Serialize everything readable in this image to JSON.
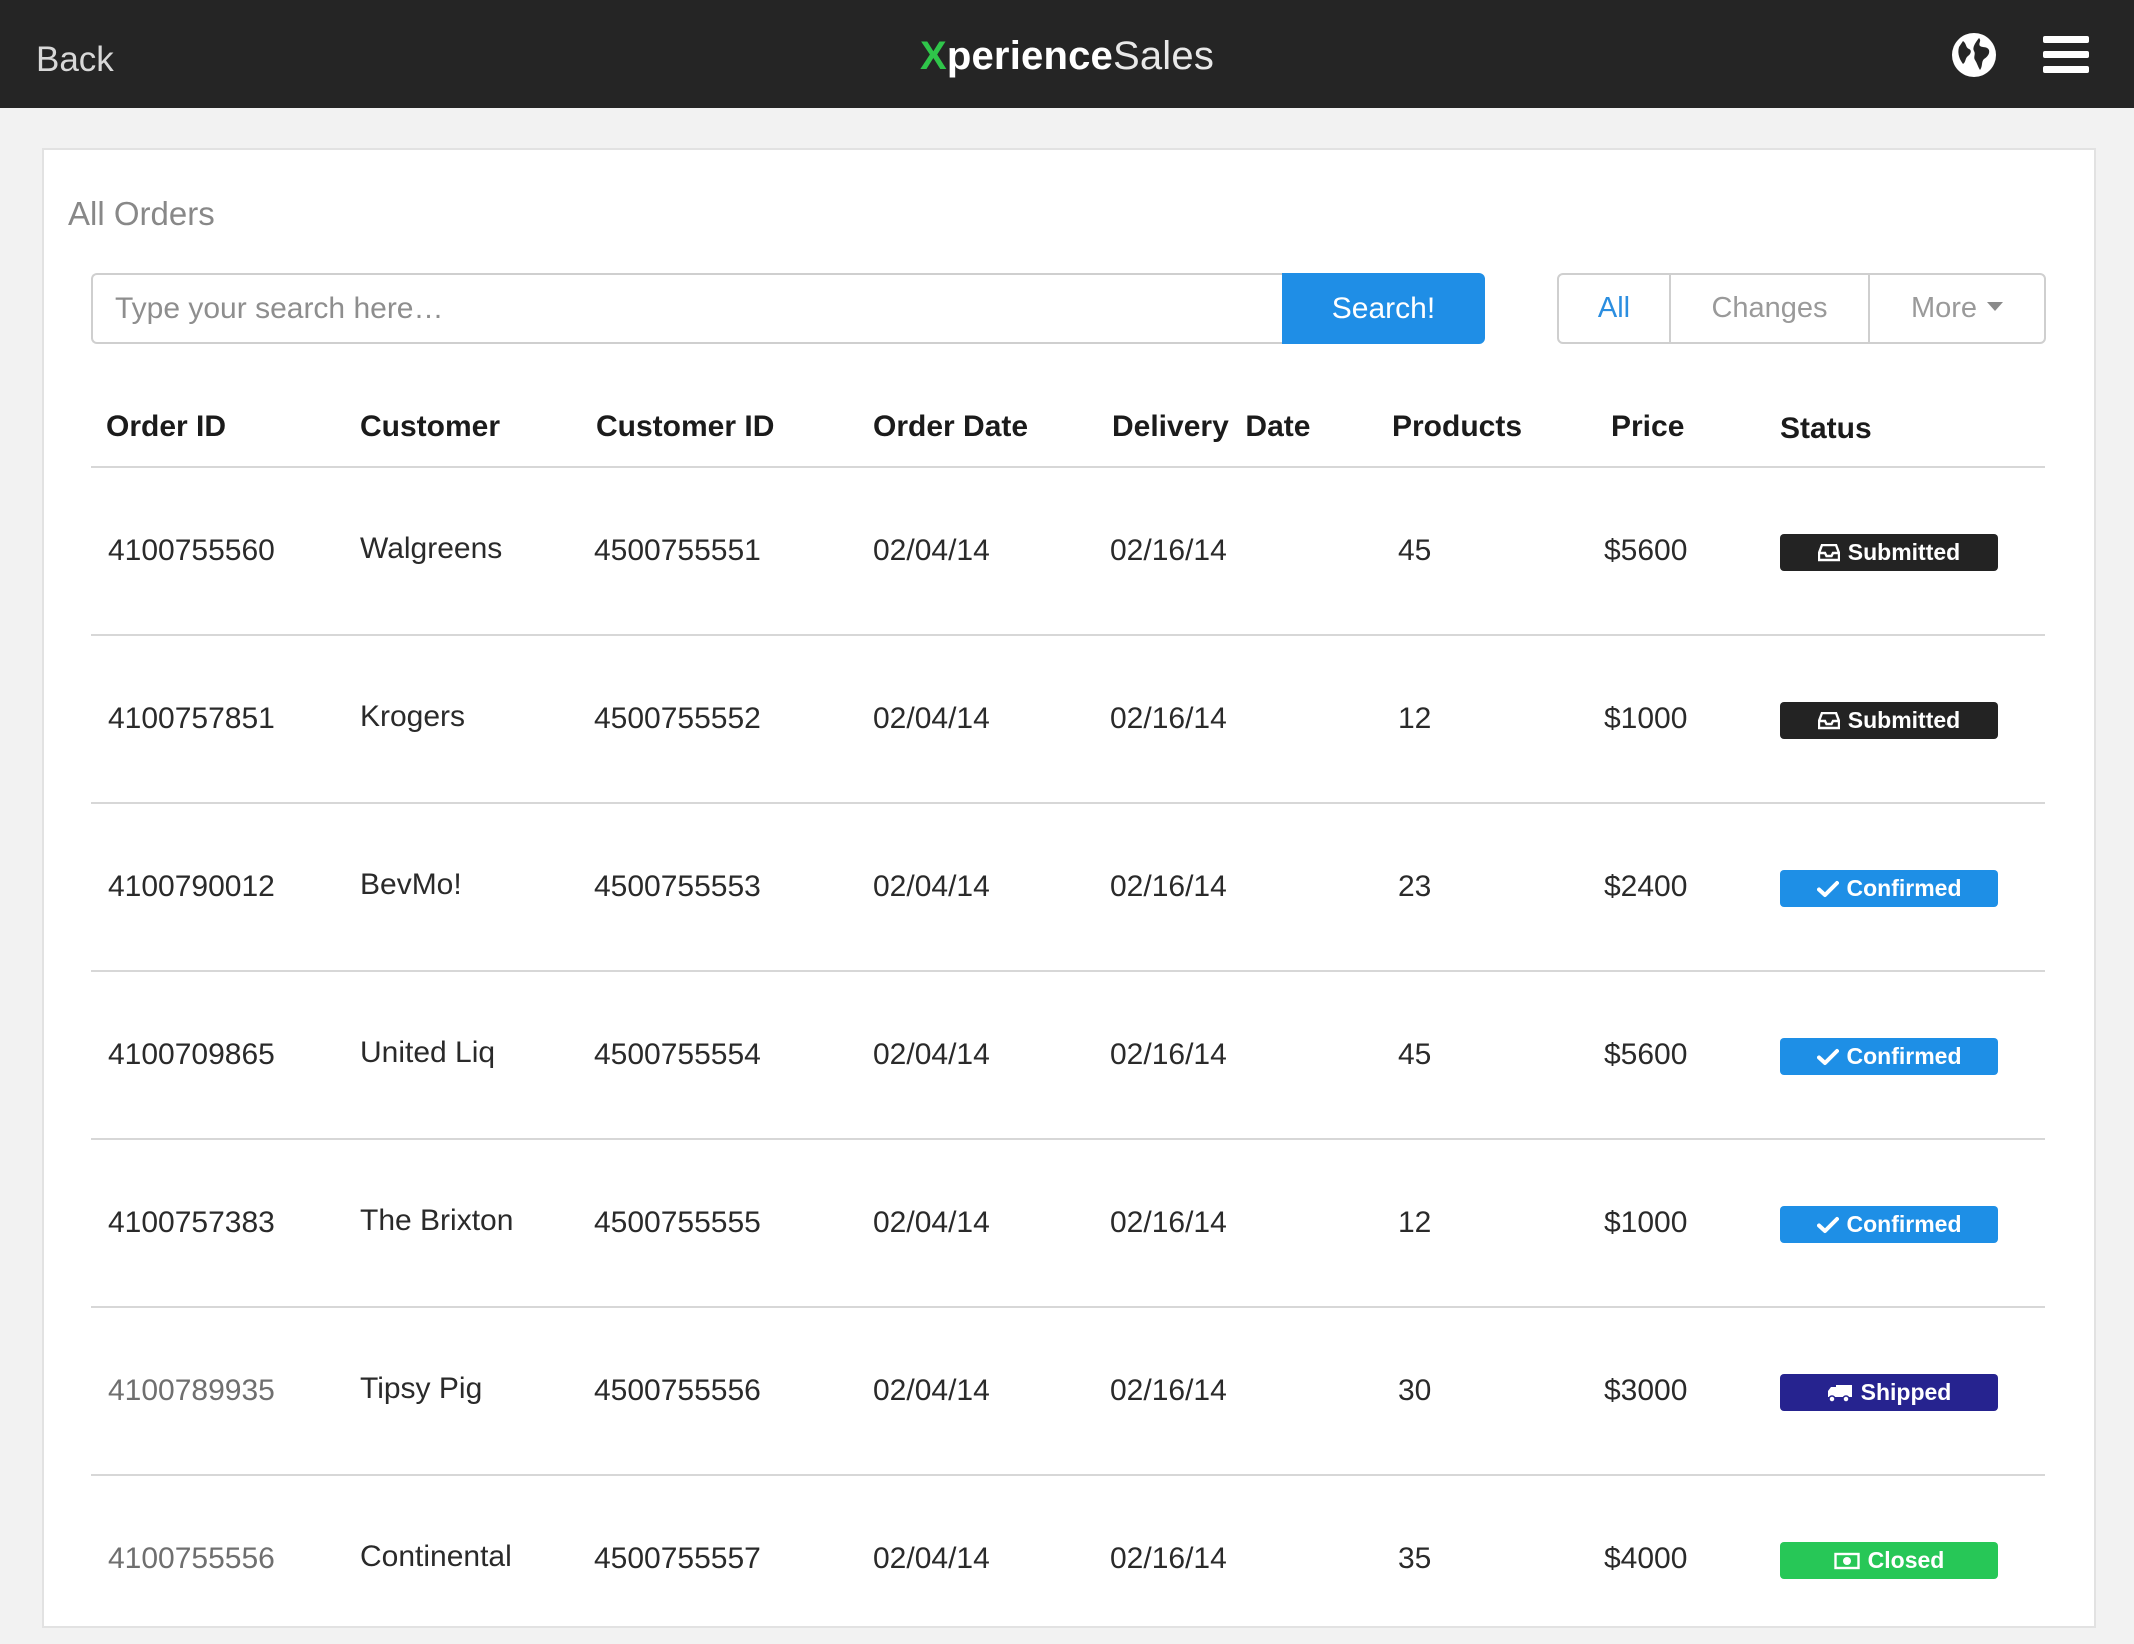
{
  "header": {
    "back_label": "Back",
    "brand": {
      "x": "X",
      "perience": "perience",
      "sales": "Sales"
    }
  },
  "page": {
    "title": "All Orders"
  },
  "search": {
    "placeholder": "Type your search here…",
    "button_label": "Search!"
  },
  "filters": {
    "all": "All",
    "changes": "Changes",
    "more": "More",
    "active": "All"
  },
  "columns": [
    "Order ID",
    "Customer",
    "Customer ID",
    "Order Date",
    "Delivery  Date",
    "Products",
    "Price",
    "Status"
  ],
  "status_colors": {
    "Submitted": "#232323",
    "Confirmed": "#1e8fe6",
    "Shipped": "#26238f",
    "Closed": "#27c757"
  },
  "rows": [
    {
      "order_id": "4100755560",
      "customer": "Walgreens",
      "customer_id": "4500755551",
      "order_date": "02/04/14",
      "delivery_date": "02/16/14",
      "products": "45",
      "price": "$5600",
      "status": "Submitted",
      "status_icon": "inbox-icon"
    },
    {
      "order_id": "4100757851",
      "customer": "Krogers",
      "customer_id": "4500755552",
      "order_date": "02/04/14",
      "delivery_date": "02/16/14",
      "products": "12",
      "price": "$1000",
      "status": "Submitted",
      "status_icon": "inbox-icon"
    },
    {
      "order_id": "4100790012",
      "customer": "BevMo!",
      "customer_id": "4500755553",
      "order_date": "02/04/14",
      "delivery_date": "02/16/14",
      "products": "23",
      "price": "$2400",
      "status": "Confirmed",
      "status_icon": "check-icon"
    },
    {
      "order_id": "4100709865",
      "customer": "United Liq",
      "customer_id": "4500755554",
      "order_date": "02/04/14",
      "delivery_date": "02/16/14",
      "products": "45",
      "price": "$5600",
      "status": "Confirmed",
      "status_icon": "check-icon"
    },
    {
      "order_id": "4100757383",
      "customer": "The Brixton",
      "customer_id": "4500755555",
      "order_date": "02/04/14",
      "delivery_date": "02/16/14",
      "products": "12",
      "price": "$1000",
      "status": "Confirmed",
      "status_icon": "check-icon"
    },
    {
      "order_id": "4100789935",
      "customer": "Tipsy Pig",
      "customer_id": "4500755556",
      "order_date": "02/04/14",
      "delivery_date": "02/16/14",
      "products": "30",
      "price": "$3000",
      "status": "Shipped",
      "status_icon": "truck-icon"
    },
    {
      "order_id": "4100755556",
      "customer": "Continental",
      "customer_id": "4500755557",
      "order_date": "02/04/14",
      "delivery_date": "02/16/14",
      "products": "35",
      "price": "$4000",
      "status": "Closed",
      "status_icon": "money-icon"
    }
  ]
}
